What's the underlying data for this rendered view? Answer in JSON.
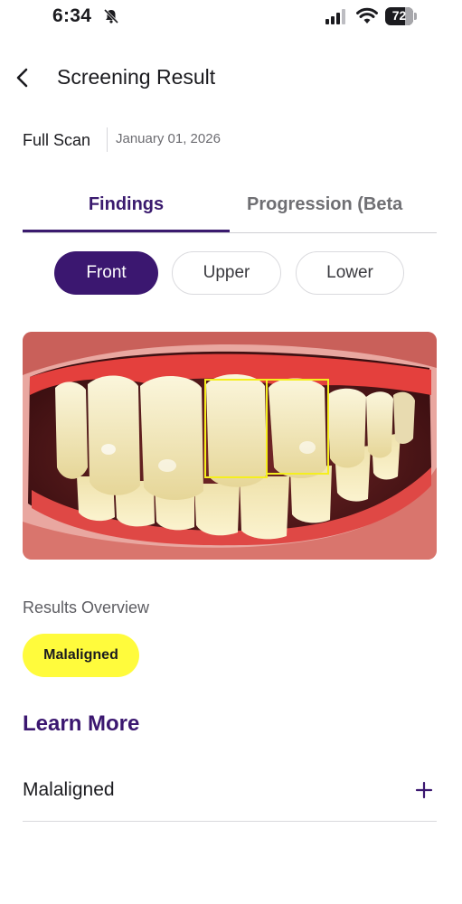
{
  "status_bar": {
    "time": "6:34",
    "battery_level": "72",
    "icons": [
      "mute-bell-icon",
      "cellular-signal-icon",
      "wifi-icon",
      "battery-icon"
    ]
  },
  "header": {
    "title": "Screening Result",
    "back_icon": "chevron-left-icon"
  },
  "scan": {
    "type": "Full Scan",
    "date": "January 01, 2026"
  },
  "tabs": [
    {
      "label": "Findings",
      "active": true
    },
    {
      "label": "Progression (Beta",
      "active": false
    }
  ],
  "views": [
    {
      "label": "Front",
      "selected": true
    },
    {
      "label": "Upper",
      "selected": false
    },
    {
      "label": "Lower",
      "selected": false
    }
  ],
  "image": {
    "subject": "front view of teeth",
    "highlight_color": "#f5ef1f"
  },
  "results": {
    "heading": "Results Overview",
    "badges": [
      {
        "label": "Malaligned",
        "color": "#fffb3c"
      }
    ]
  },
  "learn_more": {
    "heading": "Learn More",
    "items": [
      {
        "label": "Malaligned",
        "icon": "plus-icon"
      }
    ]
  },
  "colors": {
    "brand": "#3b1770",
    "badge": "#fffb3c"
  }
}
